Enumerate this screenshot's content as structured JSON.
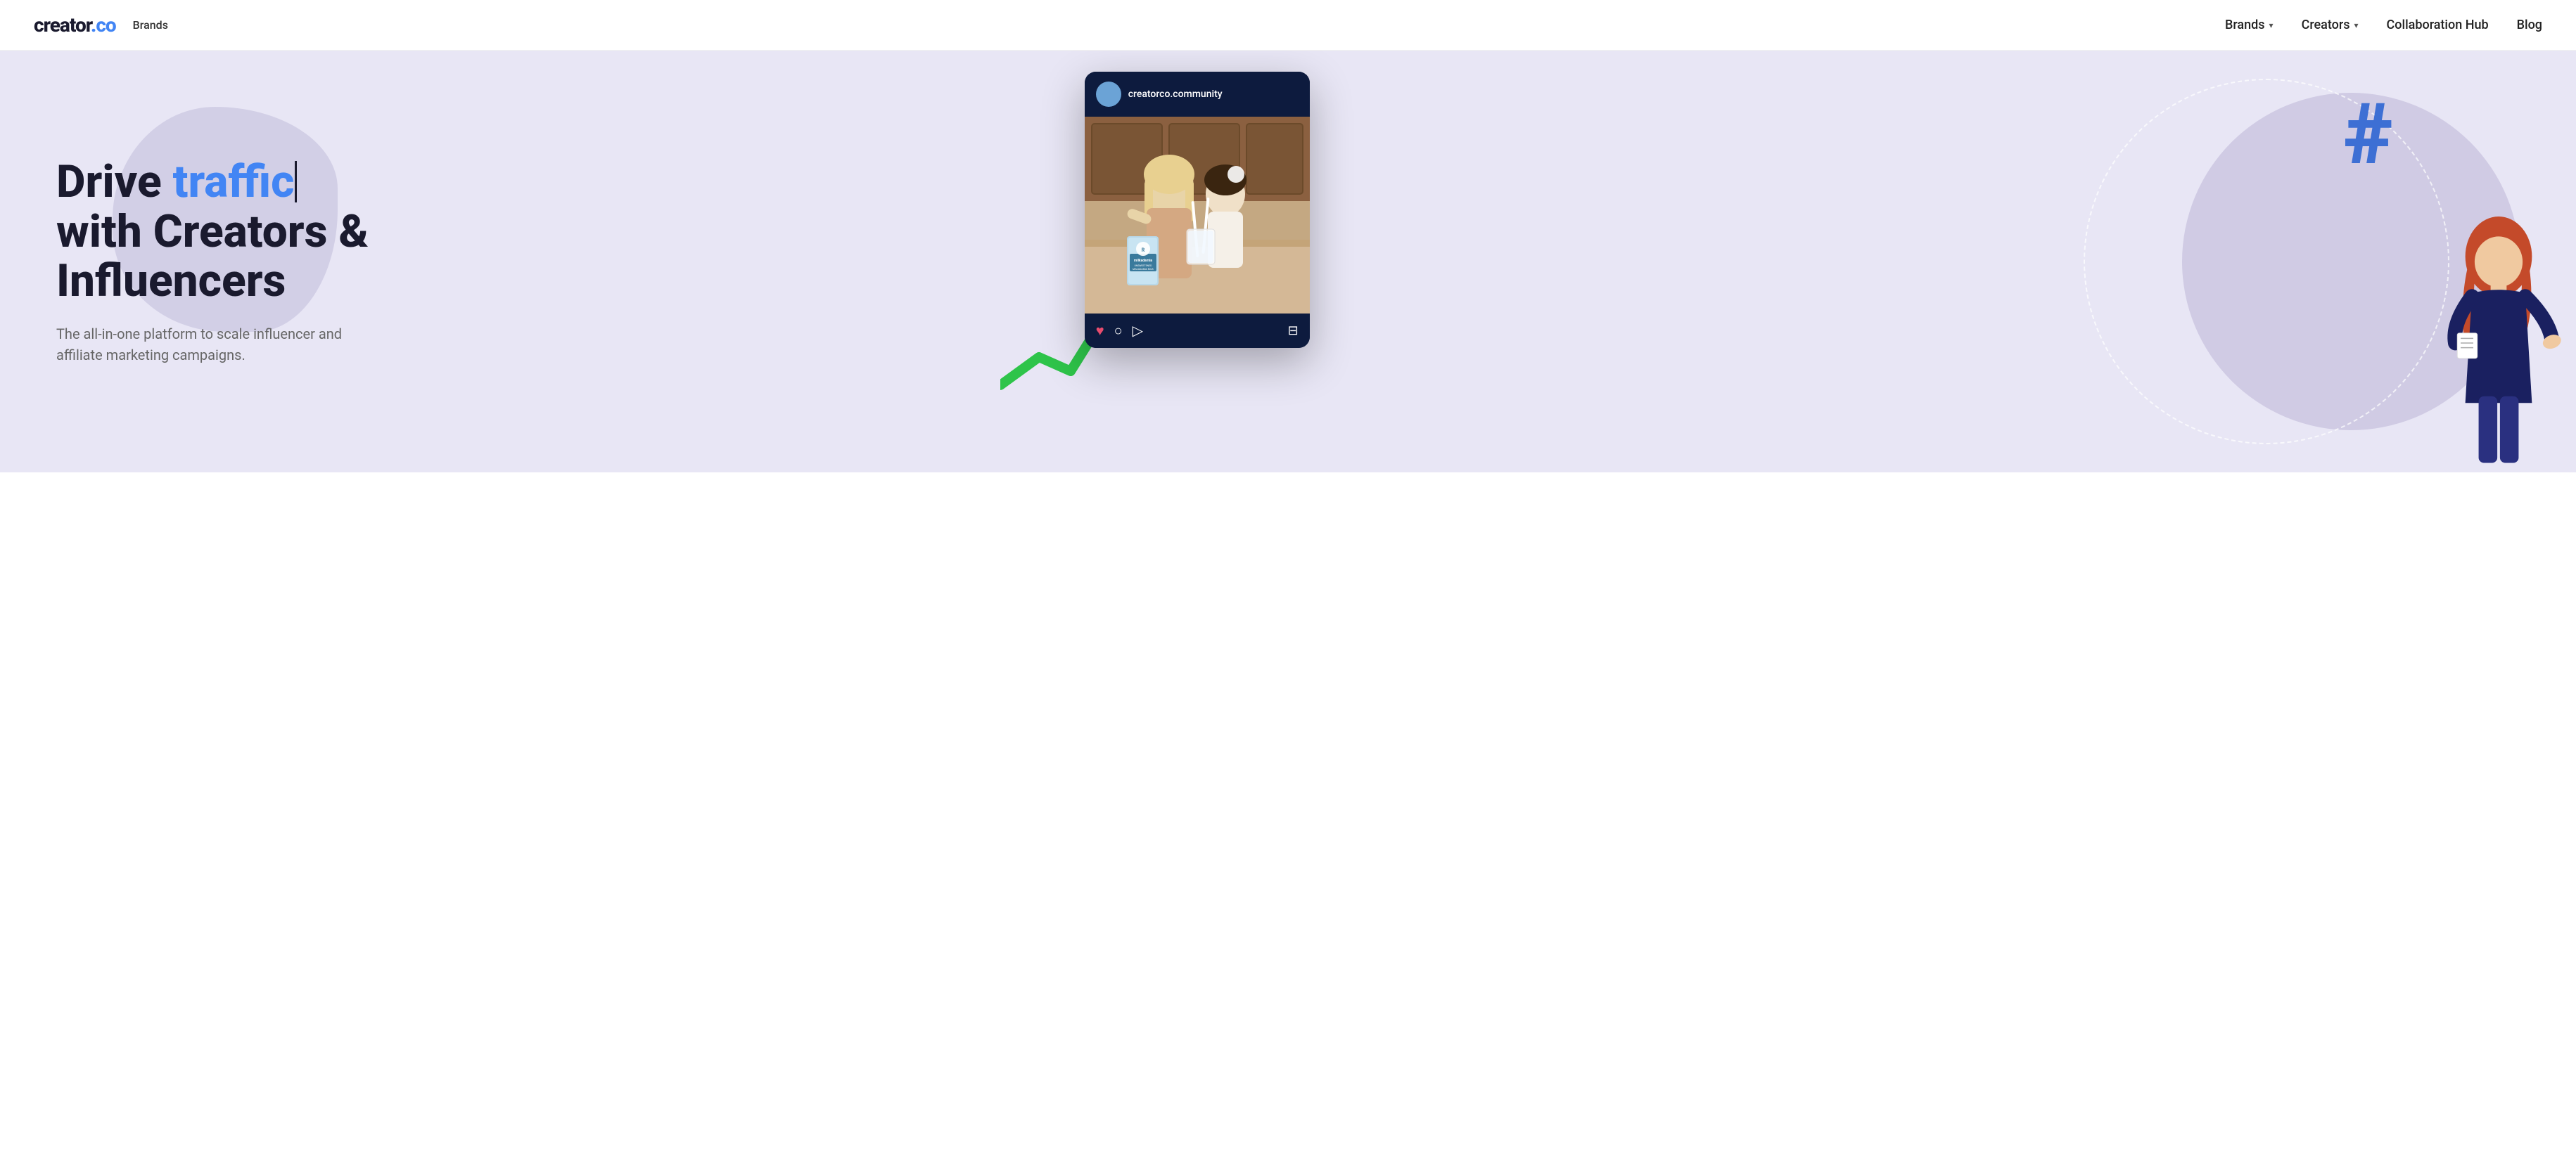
{
  "navbar": {
    "logo_creator": "creator",
    "logo_dot": ".",
    "logo_co": "co",
    "brands_label": "Brands",
    "nav_items": [
      {
        "id": "brands",
        "label": "Brands",
        "has_dropdown": true
      },
      {
        "id": "creators",
        "label": "Creators",
        "has_dropdown": true
      },
      {
        "id": "collaboration_hub",
        "label": "Collaboration Hub",
        "has_dropdown": false
      },
      {
        "id": "blog",
        "label": "Blog",
        "has_dropdown": false
      }
    ]
  },
  "hero": {
    "title_part1": "Drive ",
    "title_highlight": "traffic",
    "title_part2": "with Creators &",
    "title_part3": "Influencers",
    "subtitle": "The all-in-one platform to scale influencer and affiliate marketing campaigns.",
    "hashtag_symbol": "#",
    "instagram_username": "creatorco.community",
    "product_label": "milkadamia",
    "product_sublabel": "UNSWEETENED\nMACADAMIA MILK"
  },
  "colors": {
    "brand_blue": "#4285f4",
    "dark_navy": "#1a1a2e",
    "hero_bg": "#e8e6f5",
    "accent_green": "#2ec44a",
    "dark_card": "#0d1b3e",
    "heart_red": "#e84c6e"
  },
  "icons": {
    "chevron": "▾",
    "hashtag": "#",
    "heart": "♥",
    "comment": "○",
    "share": "▷",
    "bookmark": "🔖"
  }
}
